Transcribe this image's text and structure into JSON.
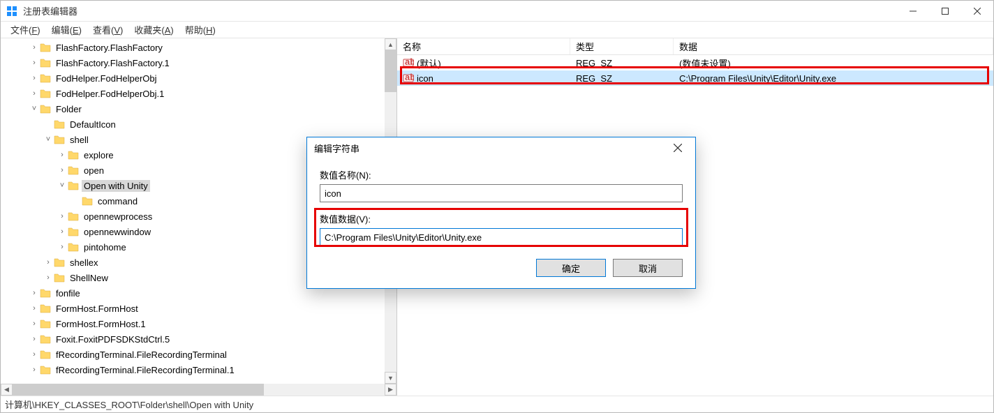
{
  "titlebar": {
    "title": "注册表编辑器"
  },
  "menu": {
    "file": "文件(",
    "file_u": "F",
    "file_end": ")",
    "edit": "编辑(",
    "edit_u": "E",
    "edit_end": ")",
    "view": "查看(",
    "view_u": "V",
    "view_end": ")",
    "fav": "收藏夹(",
    "fav_u": "A",
    "fav_end": ")",
    "help": "帮助(",
    "help_u": "H",
    "help_end": ")"
  },
  "tree": [
    {
      "indent": 2,
      "exp": ">",
      "label": "FlashFactory.FlashFactory"
    },
    {
      "indent": 2,
      "exp": ">",
      "label": "FlashFactory.FlashFactory.1"
    },
    {
      "indent": 2,
      "exp": ">",
      "label": "FodHelper.FodHelperObj"
    },
    {
      "indent": 2,
      "exp": ">",
      "label": "FodHelper.FodHelperObj.1"
    },
    {
      "indent": 2,
      "exp": "v",
      "label": "Folder"
    },
    {
      "indent": 3,
      "exp": "",
      "label": "DefaultIcon"
    },
    {
      "indent": 3,
      "exp": "v",
      "label": "shell"
    },
    {
      "indent": 4,
      "exp": ">",
      "label": "explore"
    },
    {
      "indent": 4,
      "exp": ">",
      "label": "open"
    },
    {
      "indent": 4,
      "exp": "v",
      "label": "Open with Unity",
      "selected": true
    },
    {
      "indent": 5,
      "exp": "",
      "label": "command"
    },
    {
      "indent": 4,
      "exp": ">",
      "label": "opennewprocess"
    },
    {
      "indent": 4,
      "exp": ">",
      "label": "opennewwindow"
    },
    {
      "indent": 4,
      "exp": ">",
      "label": "pintohome"
    },
    {
      "indent": 3,
      "exp": ">",
      "label": "shellex"
    },
    {
      "indent": 3,
      "exp": ">",
      "label": "ShellNew"
    },
    {
      "indent": 2,
      "exp": ">",
      "label": "fonfile"
    },
    {
      "indent": 2,
      "exp": ">",
      "label": "FormHost.FormHost"
    },
    {
      "indent": 2,
      "exp": ">",
      "label": "FormHost.FormHost.1"
    },
    {
      "indent": 2,
      "exp": ">",
      "label": "Foxit.FoxitPDFSDKStdCtrl.5"
    },
    {
      "indent": 2,
      "exp": ">",
      "label": "fRecordingTerminal.FileRecordingTerminal"
    },
    {
      "indent": 2,
      "exp": ">",
      "label": "fRecordingTerminal.FileRecordingTerminal.1"
    }
  ],
  "list": {
    "headers": {
      "name": "名称",
      "type": "类型",
      "data": "数据"
    },
    "rows": [
      {
        "name": "(默认)",
        "type": "REG_SZ",
        "data": "(数值未设置)",
        "sel": false
      },
      {
        "name": "icon",
        "type": "REG_SZ",
        "data": "C:\\Program Files\\Unity\\Editor\\Unity.exe",
        "sel": true
      }
    ]
  },
  "dialog": {
    "title": "编辑字符串",
    "name_label": "数值名称(N):",
    "name_value": "icon",
    "data_label": "数值数据(V):",
    "data_value": "C:\\Program Files\\Unity\\Editor\\Unity.exe",
    "ok": "确定",
    "cancel": "取消"
  },
  "statusbar": {
    "path": "计算机\\HKEY_CLASSES_ROOT\\Folder\\shell\\Open with Unity"
  }
}
